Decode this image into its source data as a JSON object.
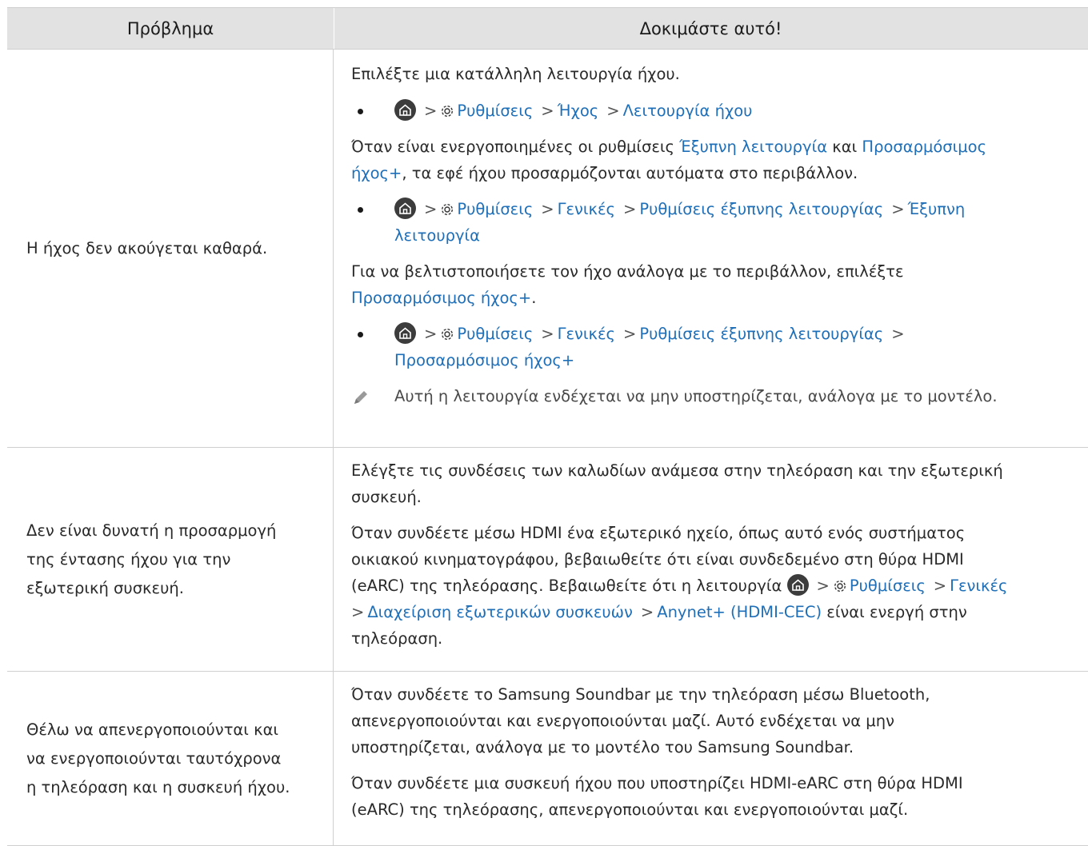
{
  "header": {
    "col1": "Πρόβλημα",
    "col2": "Δοκιμάστε αυτό!"
  },
  "path_common": {
    "settings": "Ρυθμίσεις",
    "general": "Γενικές",
    "smart_mode_settings": "Ρυθμίσεις έξυπνης λειτουργίας"
  },
  "icons": {
    "home": "home-icon",
    "settings": "gear-icon",
    "chevron": "chevron-right-icon",
    "note": "pencil-icon"
  },
  "rows": [
    {
      "problem": "Η ήχος δεν ακούγεται καθαρά.",
      "p1": "Επιλέξτε μια κατάλληλη λειτουργία ήχου.",
      "path1": {
        "sound": "Ήχος",
        "sound_mode": "Λειτουργία ήχου"
      },
      "p2": {
        "a": "Όταν είναι ενεργοποιημένες οι ρυθμίσεις ",
        "b": "Έξυπνη λειτουργία",
        "c": " και ",
        "d": "Προσαρμόσιμος",
        "e": "ήχος+",
        "f": ", τα εφέ ήχου προσαρμόζονται αυτόματα στο περιβάλλον."
      },
      "path2": {
        "smart_a": "Έξυπνη",
        "smart_b": "λειτουργία"
      },
      "p3": {
        "a": "Για να βελτιστοποιήσετε τον ήχο ανάλογα με το περιβάλλον, επιλέξτε",
        "b": "Προσαρμόσιμος ήχος+",
        "c": "."
      },
      "path3": {
        "adaptive": "Προσαρμόσιμος ήχος+"
      },
      "note": "Αυτή η λειτουργία ενδέχεται να μην υποστηρίζεται, ανάλογα με το μοντέλο."
    },
    {
      "problem_lines": [
        "Δεν είναι δυνατή η προσαρμογή",
        "της έντασης ήχου για την",
        "εξωτερική συσκευή."
      ],
      "p1_lines": [
        "Ελέγξτε τις συνδέσεις των καλωδίων ανάμεσα στην τηλεόραση και την εξωτερική",
        "συσκευή."
      ],
      "p2_lines": [
        "Όταν συνδέετε μέσω HDMI ένα εξωτερικό ηχείο, όπως αυτό ενός συστήματος",
        "οικιακού κινηματογράφου, βεβαιωθείτε ότι είναι συνδεδεμένο στη θύρα HDMI",
        "(eARC) της τηλεόρασης. Βεβαιωθείτε ότι η λειτουργία "
      ],
      "device_mgr": "Διαχείριση εξωτερικών συσκευών",
      "anynet": "Anynet+ (HDMI-CEC)",
      "tail_a": " είναι ενεργή στην",
      "tail_b": "τηλεόραση."
    },
    {
      "problem_lines": [
        "Θέλω να απενεργοποιούνται και",
        "να ενεργοποιούνται ταυτόχρονα",
        "η τηλεόραση και η συσκευή ήχου."
      ],
      "p1_lines": [
        "Όταν συνδέετε το Samsung Soundbar με την τηλεόραση μέσω Bluetooth,",
        "απενεργοποιούνται και ενεργοποιούνται μαζί. Αυτό ενδέχεται να μην",
        "υποστηρίζεται, ανάλογα με το μοντέλο του Samsung Soundbar."
      ],
      "p2_lines": [
        "Όταν συνδέετε μια συσκευή ήχου που υποστηρίζει HDMI-eARC στη θύρα HDMI",
        "(eARC) της τηλεόρασης, απενεργοποιούνται και ενεργοποιούνται μαζί."
      ]
    }
  ]
}
